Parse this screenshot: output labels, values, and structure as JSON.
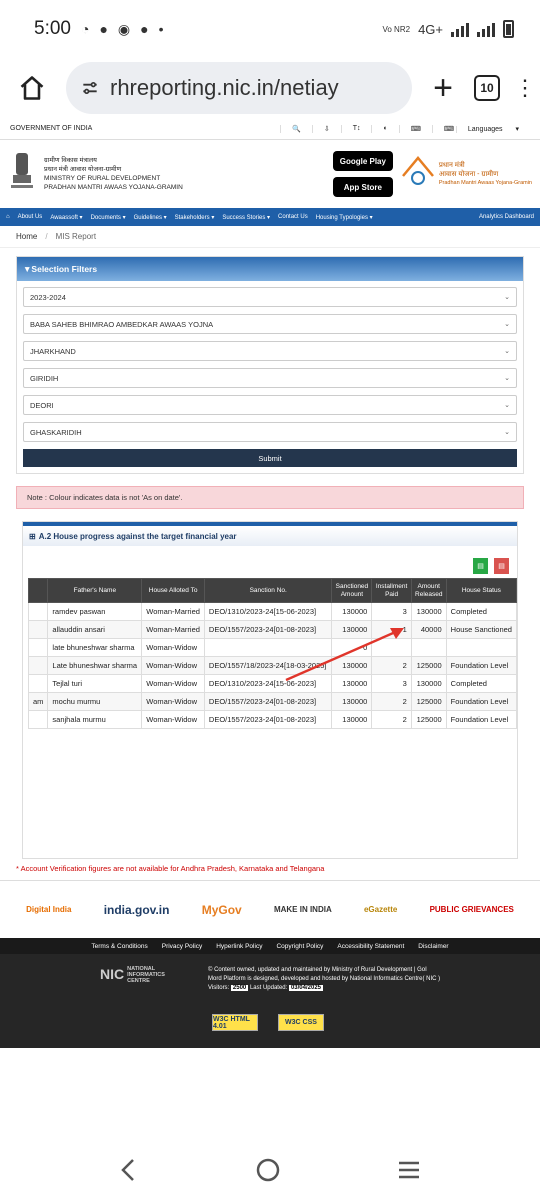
{
  "status": {
    "time": "5:00",
    "network": "4G+",
    "carrier": "Vo NR2"
  },
  "browser": {
    "url": "rhreporting.nic.in/netiay",
    "tab_count": "10"
  },
  "site": {
    "gov_label": "GOVERNMENT OF INDIA",
    "languages": "Languages",
    "ministry_hi1": "ग्रामीण विकास मंत्रालय",
    "ministry_hi2": "प्रधान मंत्री आवास योजना-ग्रामीण",
    "ministry_en1": "MINISTRY OF RURAL DEVELOPMENT",
    "ministry_en2": "PRADHAN MANTRI AWAAS YOJANA-GRAMIN",
    "google_play": "Google Play",
    "app_store": "App Store",
    "pmay_hi1": "प्रधान मंत्री",
    "pmay_hi2": "आवास योजना - ग्रामीण",
    "pmay_en": "Pradhan Mantri Awaas Yojana-Gramin"
  },
  "nav": {
    "items": [
      "About Us",
      "Awaassoft ▾",
      "Documents ▾",
      "Guidelines ▾",
      "Stakeholders ▾",
      "Success Stories ▾",
      "Contact Us",
      "Housing Typologies ▾"
    ],
    "right": "Analytics Dashboard"
  },
  "breadcrumb": {
    "home": "Home",
    "current": "MIS Report"
  },
  "filters": {
    "title": "Selection Filters",
    "year": "2023-2024",
    "scheme": "BABA SAHEB BHIMRAO AMBEDKAR AWAAS YOJNA",
    "state": "JHARKHAND",
    "district": "GIRIDIH",
    "block": "DEORI",
    "panchayat": "GHASKARIDIH",
    "submit": "Submit"
  },
  "note": "Note : Colour indicates data is not 'As on date'.",
  "report": {
    "title": "A.2 House progress against the target financial year",
    "columns": [
      "Father's Name",
      "House Alloted To",
      "Sanction No.",
      "Sanctioned Amount",
      "Installment Paid",
      "Amount Released",
      "House Status"
    ],
    "rows": [
      {
        "c0": "",
        "father": "ramdev paswan",
        "alloted": "Woman-Married",
        "sanction": "DEO/1310/2023-24[15-06-2023]",
        "amount": "130000",
        "inst": "3",
        "released": "130000",
        "status": "Completed"
      },
      {
        "c0": "",
        "father": "allauddin ansari",
        "alloted": "Woman-Married",
        "sanction": "DEO/1557/2023-24[01-08-2023]",
        "amount": "130000",
        "inst": "1",
        "released": "40000",
        "status": "House Sanctioned"
      },
      {
        "c0": "",
        "father": "late bhuneshwar sharma",
        "alloted": "Woman-Widow",
        "sanction": "",
        "amount": "0",
        "inst": "",
        "released": "",
        "status": ""
      },
      {
        "c0": "",
        "father": "Late bhuneshwar sharma",
        "alloted": "Woman-Widow",
        "sanction": "DEO/1557/18/2023-24[18-03-2025]",
        "amount": "130000",
        "inst": "2",
        "released": "125000",
        "status": "Foundation Level"
      },
      {
        "c0": "",
        "father": "Tejlal turi",
        "alloted": "Woman-Widow",
        "sanction": "DEO/1310/2023-24[15-06-2023]",
        "amount": "130000",
        "inst": "3",
        "released": "130000",
        "status": "Completed"
      },
      {
        "c0": "am",
        "father": "mochu murmu",
        "alloted": "Woman-Widow",
        "sanction": "DEO/1557/2023-24[01-08-2023]",
        "amount": "130000",
        "inst": "2",
        "released": "125000",
        "status": "Foundation Level"
      },
      {
        "c0": "",
        "father": "sanjhala murmu",
        "alloted": "Woman-Widow",
        "sanction": "DEO/1557/2023-24[01-08-2023]",
        "amount": "130000",
        "inst": "2",
        "released": "125000",
        "status": "Foundation Level"
      }
    ]
  },
  "account_note": "* Account Verification figures are not available for Andhra Pradesh, Karnataka and Telangana",
  "logos": [
    "Digital India",
    "india.gov.in",
    "MyGov",
    "MAKE IN INDIA",
    "eGazette",
    "PUBLIC GRIEVANCES"
  ],
  "footer": {
    "links": [
      "Terms & Conditions",
      "Privacy Policy",
      "Hyperlink Policy",
      "Copyright Policy",
      "Accessibility Statement",
      "Disclaimer"
    ],
    "nic": "NIC",
    "nic_full": "NATIONAL INFORMATICS CENTRE",
    "line1": "© Content owned, updated and maintained by Ministry of Rural Development | GoI",
    "line2": "Mord Platform is designed, developed and hosted by National Informatics Centre( NIC )",
    "visitors_label": "Visitors:",
    "visitors": "2500",
    "updated_label": "Last Updated:",
    "updated": "03/04/2025",
    "w3_html": "W3C HTML 4.01",
    "w3_css": "W3C CSS"
  }
}
